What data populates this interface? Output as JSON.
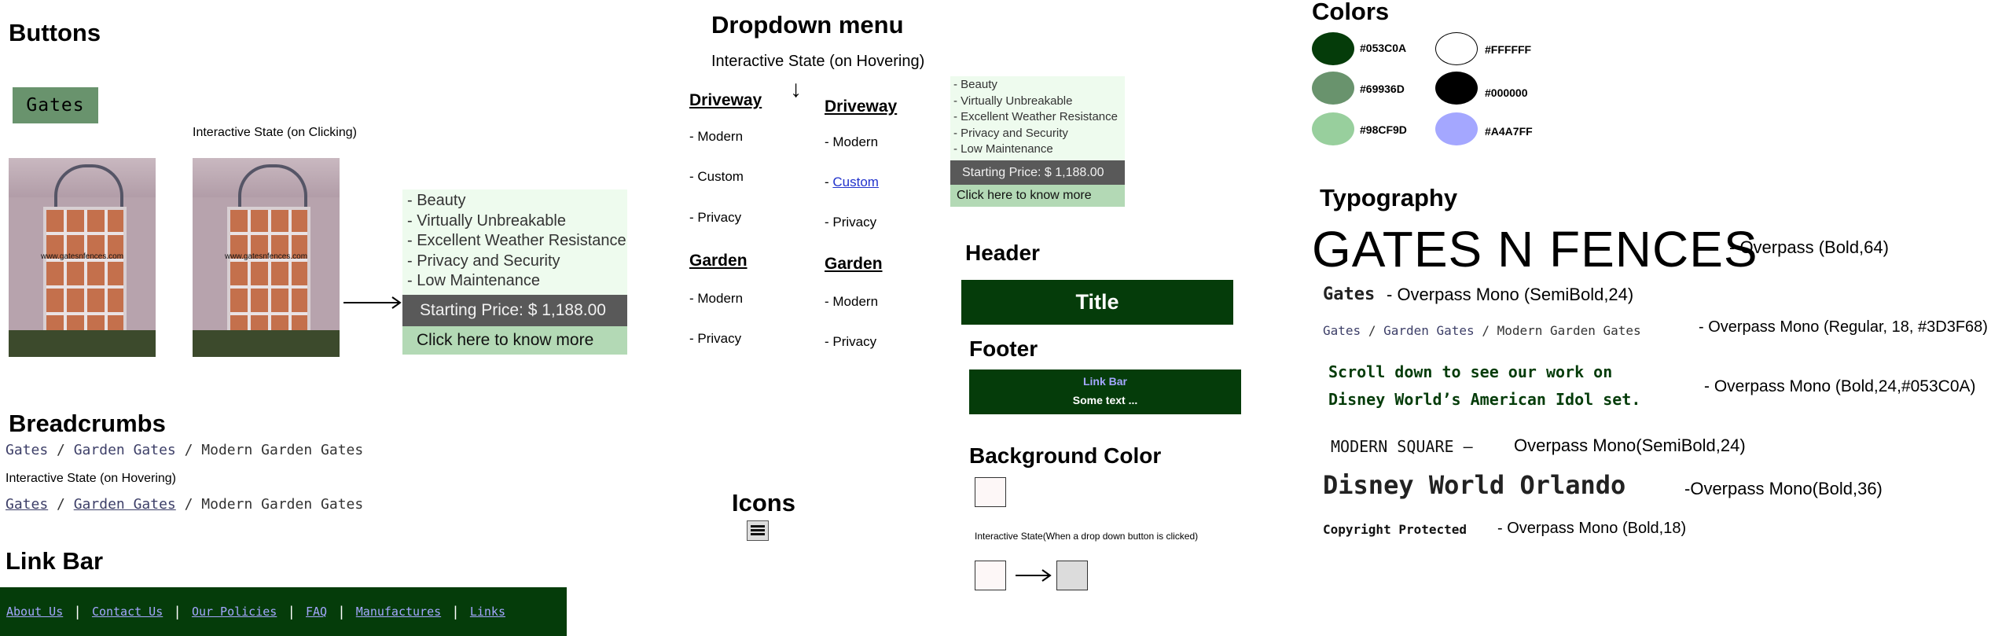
{
  "buttons": {
    "heading": "Buttons",
    "gates_label": "Gates",
    "click_state_label": "Interactive State (on Clicking)",
    "image_watermark": "www.gatesnfences.com",
    "card": {
      "features": [
        "- Beauty",
        "- Virtually Unbreakable",
        "- Excellent Weather Resistance",
        "- Privacy and Security",
        "- Low Maintenance"
      ],
      "price": "Starting Price: $ 1,188.00",
      "cta": "Click here to know more"
    }
  },
  "breadcrumbs": {
    "heading": "Breadcrumbs",
    "items": [
      "Gates",
      "Garden Gates",
      "Modern Garden Gates"
    ],
    "separator": "/",
    "hover_label": "Interactive State (on Hovering)"
  },
  "link_bar": {
    "heading": "Link Bar",
    "links": [
      "About Us",
      "Contact Us",
      "Our Policies",
      "FAQ",
      "Manufactures",
      "Links"
    ],
    "separator": "|"
  },
  "dropdown": {
    "heading": "Dropdown menu",
    "hover_label": "Interactive State (on Hovering)",
    "arrow": "↓",
    "driveway": "Driveway",
    "garden": "Garden",
    "driveway_items": [
      "- Modern",
      "- Custom",
      "- Privacy"
    ],
    "garden_items": [
      "- Modern",
      "- Privacy"
    ],
    "hover_prefix": "- ",
    "hover_link": "Custom",
    "card": {
      "features": [
        "- Beauty",
        "- Virtually Unbreakable",
        "- Excellent Weather Resistance",
        "- Privacy and Security",
        "- Low Maintenance"
      ],
      "price": "Starting Price: $ 1,188.00",
      "cta": "Click here to know more"
    }
  },
  "icons": {
    "heading": "Icons",
    "menu_icon": "hamburger-menu-icon"
  },
  "header": {
    "heading": "Header",
    "title": "Title"
  },
  "footer": {
    "heading": "Footer",
    "link_bar": "Link Bar",
    "text": "Some text ..."
  },
  "background": {
    "heading": "Background Color",
    "state_label": "Interactive State(When a drop down button is clicked)",
    "arrow": "⟶"
  },
  "colors": {
    "heading": "Colors",
    "swatches": [
      {
        "label": "#053C0A",
        "color": "#053C0A"
      },
      {
        "label": "#69936D",
        "color": "#69936D"
      },
      {
        "label": "#98CF9D",
        "color": "#98CF9D"
      },
      {
        "label": "#FFFFFF",
        "color": "#FFFFFF"
      },
      {
        "label": "#000000",
        "color": "#000000"
      },
      {
        "label": "#A4A7FF",
        "color": "#A4A7FF"
      }
    ]
  },
  "typography": {
    "heading": "Typography",
    "title_sample": "GATES N FENCES",
    "title_desc": "- Overpass (Bold,64)",
    "gates_sample": "Gates",
    "gates_desc": "- Overpass Mono (SemiBold,24)",
    "crumb_desc": "- Overpass Mono (Regular, 18, #3D3F68)",
    "scroll_line1": "Scroll down to see our work on",
    "scroll_line2": "Disney World’s American Idol set.",
    "scroll_desc": "- Overpass Mono (Bold,24,#053C0A)",
    "modern_sample": "MODERN SQUARE –",
    "modern_desc": "Overpass Mono(SemiBold,24)",
    "disney_sample": "Disney World Orlando",
    "disney_desc": "-Overpass Mono(Bold,36)",
    "copyright_sample": "Copyright Protected",
    "copyright_desc": "- Overpass Mono (Bold,18)"
  }
}
